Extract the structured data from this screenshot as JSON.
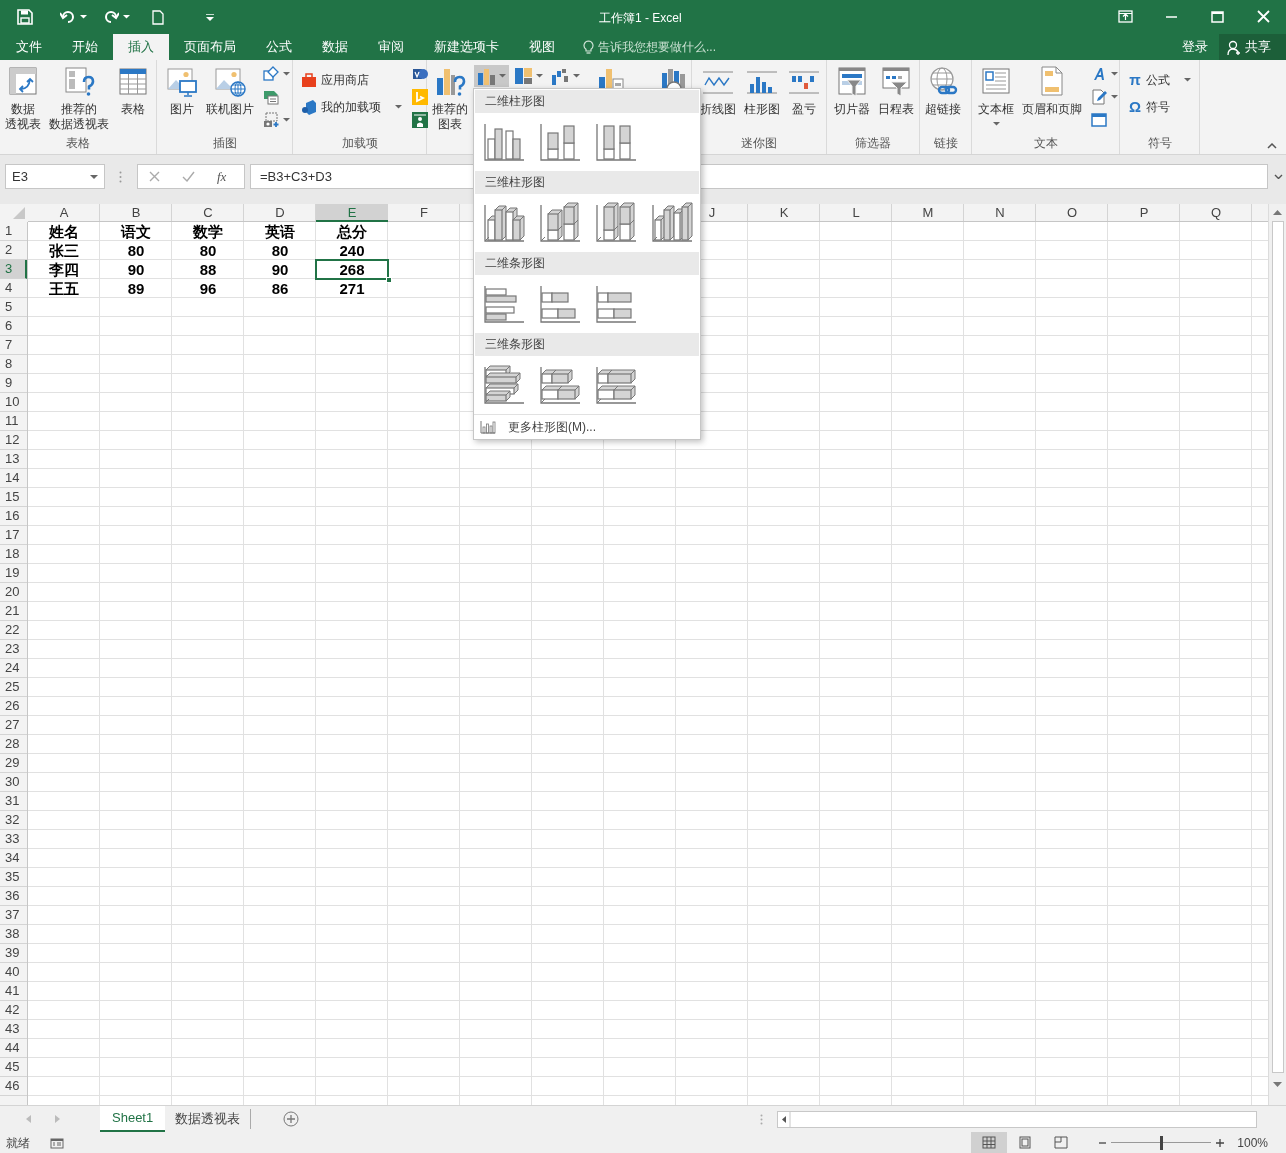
{
  "title_bar": {
    "title": "工作簿1 - Excel"
  },
  "tabs": [
    {
      "label": "文件",
      "selected": false
    },
    {
      "label": "开始",
      "selected": false
    },
    {
      "label": "插入",
      "selected": true
    },
    {
      "label": "页面布局",
      "selected": false
    },
    {
      "label": "公式",
      "selected": false
    },
    {
      "label": "数据",
      "selected": false
    },
    {
      "label": "审阅",
      "selected": false
    },
    {
      "label": "新建选项卡",
      "selected": false
    },
    {
      "label": "视图",
      "selected": false
    }
  ],
  "tell_me": {
    "placeholder": "告诉我您想要做什么..."
  },
  "account": {
    "sign_in": "登录",
    "share": "共享"
  },
  "ribbon": {
    "groups": [
      {
        "label": "表格",
        "items": [
          {
            "kind": "large",
            "lines": [
              "数据",
              "透视表"
            ]
          },
          {
            "kind": "large",
            "lines": [
              "推荐的",
              "数据透视表"
            ]
          },
          {
            "kind": "large",
            "lines": [
              "表格"
            ]
          }
        ]
      },
      {
        "label": "插图",
        "items": [
          {
            "kind": "large",
            "lines": [
              "图片"
            ]
          },
          {
            "kind": "large",
            "lines": [
              "联机图片"
            ]
          },
          {
            "kind": "icon_column"
          }
        ]
      },
      {
        "label": "加载项",
        "items": [
          {
            "kind": "small_column",
            "buttons": [
              {
                "label": "应用商店",
                "menu": false
              },
              {
                "label": "我的加载项",
                "menu": true
              }
            ]
          },
          {
            "kind": "icon_column"
          }
        ]
      },
      {
        "items": [
          {
            "kind": "large",
            "lines": [
              "推荐的",
              "图表"
            ]
          },
          {
            "kind": "chart_buttons",
            "buttons": [
              {
                "pressed": true
              },
              {
                "pressed": false
              },
              {
                "pressed": false
              }
            ]
          },
          {
            "kind": "covered"
          },
          {
            "kind": "covered"
          }
        ]
      },
      {
        "label": "迷你图",
        "items": [
          {
            "kind": "large",
            "lines": [
              "折线图"
            ]
          },
          {
            "kind": "large",
            "lines": [
              "柱形图"
            ]
          },
          {
            "kind": "large",
            "lines": [
              "盈亏"
            ]
          }
        ]
      },
      {
        "label": "筛选器",
        "items": [
          {
            "kind": "large",
            "lines": [
              "切片器"
            ]
          },
          {
            "kind": "large",
            "lines": [
              "日程表"
            ]
          }
        ]
      },
      {
        "label": "链接",
        "items": [
          {
            "kind": "large",
            "lines": [
              "超链接"
            ]
          }
        ]
      },
      {
        "label": "文本",
        "items": [
          {
            "kind": "large",
            "lines": [
              "文本框"
            ],
            "menu": true
          },
          {
            "kind": "large",
            "lines": [
              "页眉和页脚"
            ],
            "menu": false
          },
          {
            "kind": "icon_column"
          }
        ]
      },
      {
        "label": "符号",
        "items": [
          {
            "kind": "small_column",
            "buttons": [
              {
                "glyph": "π",
                "label": "公式",
                "menu": true
              },
              {
                "glyph": "Ω",
                "label": "符号",
                "menu": false
              }
            ]
          }
        ]
      }
    ]
  },
  "formula_bar": {
    "name_box": "E3",
    "insert_function": "fx",
    "formula": "=B3+C3+D3"
  },
  "columns": [
    {
      "label": "A",
      "selected": false
    },
    {
      "label": "B",
      "selected": false
    },
    {
      "label": "C",
      "selected": false
    },
    {
      "label": "D",
      "selected": false
    },
    {
      "label": "E",
      "selected": true
    },
    {
      "label": "F",
      "selected": false
    }
  ],
  "columns_after_menu": [
    {
      "label": "J",
      "selected": false
    },
    {
      "label": "K",
      "selected": false
    },
    {
      "label": "L",
      "selected": false
    },
    {
      "label": "M",
      "selected": false
    },
    {
      "label": "N",
      "selected": false
    },
    {
      "label": "O",
      "selected": false
    },
    {
      "label": "P",
      "selected": false
    },
    {
      "label": "Q",
      "selected": false
    }
  ],
  "rows": [
    {
      "label": "1",
      "selected": false
    },
    {
      "label": "2",
      "selected": false
    },
    {
      "label": "3",
      "selected": true
    },
    {
      "label": "4",
      "selected": false
    },
    {
      "label": "5",
      "selected": false
    },
    {
      "label": "6",
      "selected": false
    },
    {
      "label": "7",
      "selected": false
    },
    {
      "label": "8",
      "selected": false
    },
    {
      "label": "9",
      "selected": false
    },
    {
      "label": "10",
      "selected": false
    },
    {
      "label": "11",
      "selected": false
    },
    {
      "label": "12",
      "selected": false
    },
    {
      "label": "13",
      "selected": false
    },
    {
      "label": "14",
      "selected": false
    },
    {
      "label": "15",
      "selected": false
    },
    {
      "label": "16",
      "selected": false
    },
    {
      "label": "17",
      "selected": false
    },
    {
      "label": "18",
      "selected": false
    },
    {
      "label": "19",
      "selected": false
    },
    {
      "label": "20",
      "selected": false
    },
    {
      "label": "21",
      "selected": false
    },
    {
      "label": "22",
      "selected": false
    },
    {
      "label": "23",
      "selected": false
    },
    {
      "label": "24",
      "selected": false
    },
    {
      "label": "25",
      "selected": false
    },
    {
      "label": "26",
      "selected": false
    },
    {
      "label": "27",
      "selected": false
    },
    {
      "label": "28",
      "selected": false
    },
    {
      "label": "29",
      "selected": false
    },
    {
      "label": "30",
      "selected": false
    },
    {
      "label": "31",
      "selected": false
    },
    {
      "label": "32",
      "selected": false
    },
    {
      "label": "33",
      "selected": false
    },
    {
      "label": "34",
      "selected": false
    },
    {
      "label": "35",
      "selected": false
    },
    {
      "label": "36",
      "selected": false
    },
    {
      "label": "37",
      "selected": false
    },
    {
      "label": "38",
      "selected": false
    },
    {
      "label": "39",
      "selected": false
    },
    {
      "label": "40",
      "selected": false
    },
    {
      "label": "41",
      "selected": false
    },
    {
      "label": "42",
      "selected": false
    },
    {
      "label": "43",
      "selected": false
    },
    {
      "label": "44",
      "selected": false
    },
    {
      "label": "45",
      "selected": false
    },
    {
      "label": "46",
      "selected": false
    }
  ],
  "cells": [
    [
      {
        "text": "姓名",
        "selected": false
      },
      {
        "text": "语文",
        "selected": false
      },
      {
        "text": "数学",
        "selected": false
      },
      {
        "text": "英语",
        "selected": false
      },
      {
        "text": "总分",
        "selected": false
      }
    ],
    [
      {
        "text": "张三",
        "selected": false
      },
      {
        "text": "80",
        "selected": false
      },
      {
        "text": "80",
        "selected": false
      },
      {
        "text": "80",
        "selected": false
      },
      {
        "text": "240",
        "selected": false
      }
    ],
    [
      {
        "text": "李四",
        "selected": false
      },
      {
        "text": "90",
        "selected": false
      },
      {
        "text": "88",
        "selected": false
      },
      {
        "text": "90",
        "selected": false
      },
      {
        "text": "268",
        "selected": true
      }
    ],
    [
      {
        "text": "王五",
        "selected": false
      },
      {
        "text": "89",
        "selected": false
      },
      {
        "text": "96",
        "selected": false
      },
      {
        "text": "86",
        "selected": false
      },
      {
        "text": "271",
        "selected": false
      }
    ]
  ],
  "chart_menu": {
    "sections": [
      {
        "title": "二维柱形图",
        "charts": [
          {
            "kind": "clustered"
          },
          {
            "kind": "stacked"
          },
          {
            "kind": "stacked100"
          }
        ]
      },
      {
        "title": "三维柱形图",
        "charts": [
          {
            "kind": "clustered_3d"
          },
          {
            "kind": "stacked_3d"
          },
          {
            "kind": "stacked100_3d"
          },
          {
            "kind": "column_3d"
          }
        ]
      },
      {
        "title": "二维条形图",
        "charts": [
          {
            "kind": "bar_clustered"
          },
          {
            "kind": "bar_stacked"
          },
          {
            "kind": "bar_stacked100"
          }
        ]
      },
      {
        "title": "三维条形图",
        "charts": [
          {
            "kind": "bar_clustered_3d"
          },
          {
            "kind": "bar_stacked_3d"
          },
          {
            "kind": "bar_stacked100_3d"
          }
        ]
      }
    ],
    "more": "更多柱形图(M)..."
  },
  "sheet_tabs": [
    {
      "label": "Sheet1",
      "selected": true
    },
    {
      "label": "数据透视表",
      "selected": false
    }
  ],
  "status_bar": {
    "text": "就绪",
    "views": [
      {
        "selected": true
      },
      {
        "selected": false
      },
      {
        "selected": false
      }
    ],
    "zoom": {
      "level": 0.5,
      "reading": "100%"
    }
  }
}
